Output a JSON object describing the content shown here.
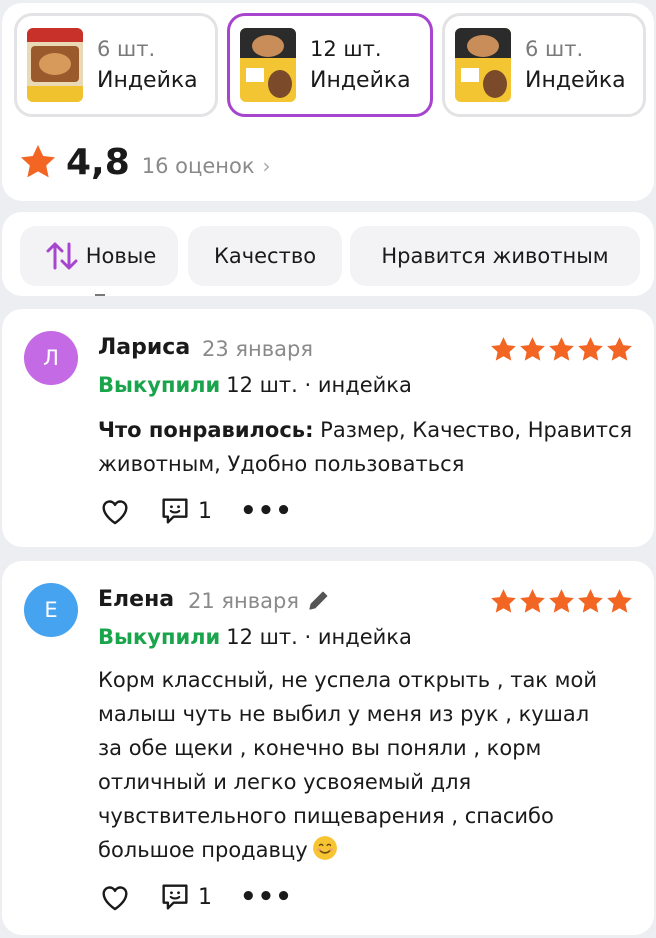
{
  "variants": [
    {
      "qty": "6 шт.",
      "flavor": "Индейка",
      "selected": false
    },
    {
      "qty": "12 шт.",
      "flavor": "Индейка",
      "selected": true
    },
    {
      "qty": "6 шт.",
      "flavor": "Индейка",
      "selected": false
    }
  ],
  "rating": {
    "score": "4,8",
    "count": "16 оценок",
    "chevron": "›"
  },
  "filters": {
    "sort_label": "Новые",
    "chip1": "Качество",
    "chip2": "Нравится животным"
  },
  "reviews": [
    {
      "avatar_letter": "Л",
      "avatar_color": "#c36ae4",
      "author": "Лариса",
      "date": "23 января",
      "stars": 5,
      "bought_label": "Выкупили",
      "bought_detail": "12 шт. · индейка",
      "liked_label": "Что понравилось:",
      "liked_text": "Размер, Качество, Нравится животным, Удобно пользоваться",
      "comments": "1",
      "more": "•••"
    },
    {
      "avatar_letter": "Е",
      "avatar_color": "#46a3f0",
      "author": "Елена",
      "date": "21 января",
      "edited": true,
      "stars": 5,
      "bought_label": "Выкупили",
      "bought_detail": "12 шт. · индейка",
      "text": "Корм классный, не успела открыть , так мой малыш чуть не выбил у меня из рук , кушал за обе щеки , конечно вы поняли , корм отличный и легко усвояемый для чувствительного пищеварения , спасибо большое продавцу",
      "comments": "1",
      "more": "•••"
    }
  ],
  "colors": {
    "accent": "#a845cf",
    "star": "#f26522",
    "bought": "#1aa44b"
  }
}
